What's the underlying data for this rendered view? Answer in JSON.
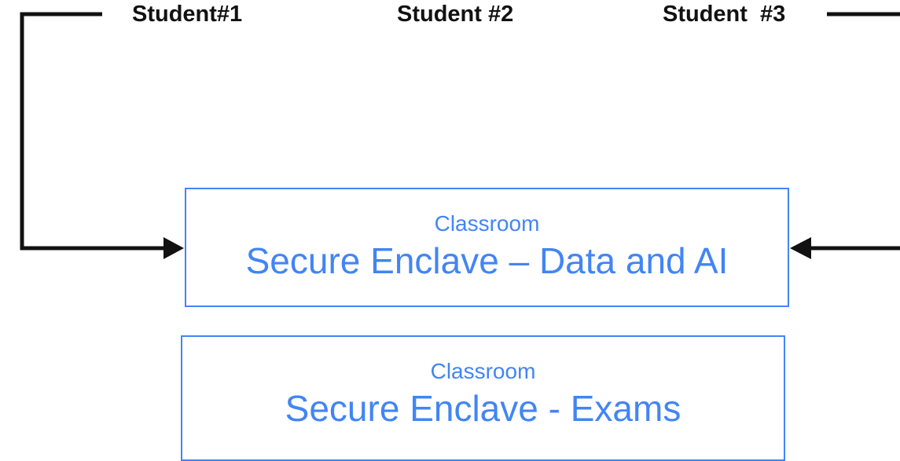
{
  "students": {
    "student_1": "Student#1",
    "student_2": "Student #2",
    "student_3": "Student  #3"
  },
  "enclaves": {
    "data_ai": {
      "kicker": "Classroom",
      "title": "Secure Enclave – Data and AI"
    },
    "exams": {
      "kicker": "Classroom",
      "title": "Secure Enclave - Exams"
    }
  },
  "colors": {
    "accent": "#4285f4",
    "connector": "#111111"
  }
}
